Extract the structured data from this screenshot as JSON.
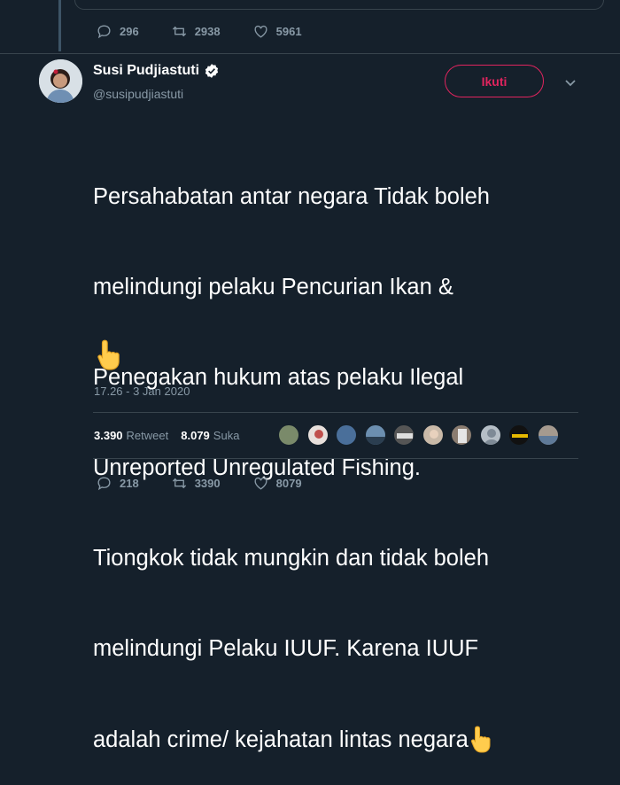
{
  "top_actions": {
    "reply_count": "296",
    "retweet_count": "2938",
    "like_count": "5961"
  },
  "author": {
    "name": "Susi Pudjiastuti",
    "handle": "@susipudjiastuti",
    "verified": true,
    "avatar_icon": "profile-photo"
  },
  "follow_button": {
    "label": "Ikuti",
    "color": "#e0245e"
  },
  "tweet": {
    "lines": [
      "Persahabatan antar negara Tidak boleh",
      "melindungi pelaku Pencurian Ikan &",
      "Penegakan hukum atas pelaku Ilegal",
      "Unreported Unregulated Fishing.",
      "Tiongkok tidak mungkin dan tidak boleh",
      "melindungi Pelaku IUUF. Karena IUUF",
      "adalah crime/ kejahatan lintas negara"
    ],
    "emoji": "point-up-hand-icon",
    "timestamp": "17.26 - 3 Jan 2020"
  },
  "stats": {
    "retweets_count": "3.390",
    "retweets_label": "Retweet",
    "likes_count": "8.079",
    "likes_label": "Suka"
  },
  "likers": [
    "avatar-1",
    "avatar-2",
    "avatar-3",
    "avatar-4",
    "avatar-5",
    "avatar-6",
    "avatar-7",
    "avatar-8",
    "avatar-9"
  ],
  "bottom_actions": {
    "reply_count": "218",
    "retweet_count": "3390",
    "like_count": "8079"
  },
  "colors": {
    "background": "#15202b",
    "muted": "#8899a6",
    "border": "#38444d",
    "verified": "#ffffff"
  }
}
